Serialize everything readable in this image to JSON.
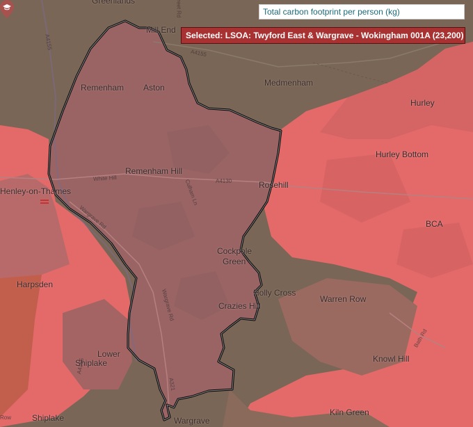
{
  "metric_label": "Total carbon footprint per person (kg)",
  "selected_label": "Selected: LSOA: Twyford East & Wargrave - Wokingham 001A (23,200)",
  "colors": {
    "high": "#e46a6a",
    "medium": "#c06060",
    "selected": "#9a6464",
    "low": "#7a6656",
    "boundary": "#000000",
    "selected_badge": "#a83232"
  },
  "places": {
    "greenlands": "Greenlands",
    "mill_end": "Mill End",
    "remenham": "Remenham",
    "aston": "Aston",
    "medmenham": "Medmenham",
    "hurley": "Hurley",
    "hurley_bottom": "Hurley Bottom",
    "remenham_hill": "Remenham Hill",
    "rosehill": "Rosehill",
    "henley": "Henley-on-Thames",
    "bca": "BCA",
    "cockpole": "Cockpole",
    "green": "Green",
    "harpsden": "Harpsden",
    "holly_cross": "Holly Cross",
    "warren_row": "Warren Row",
    "crazies_hill": "Crazies Hill",
    "lower": "Lower",
    "shiplake_lower": "Shiplake",
    "knowl_hill": "Knowl Hill",
    "kiln_green": "Kiln Green",
    "shiplake": "Shiplake",
    "wargrave": "Wargrave"
  },
  "roads": {
    "a4155_top": "A4155",
    "a4155_left": "A4155",
    "a4155_right": "A4155",
    "white_hill": "White Hill",
    "a4130": "A4130",
    "culham_ln": "Culham Ln",
    "wargrave_rd": "Wargrave Rd",
    "wargrave_rd2": "Wargrave Rd",
    "a321": "A321",
    "bath_rd": "Bath Rd",
    "harpsden_row": "Row",
    "street_rd": "Street Rd"
  },
  "icons": {
    "poi": "graduation-cap-pin-icon"
  }
}
